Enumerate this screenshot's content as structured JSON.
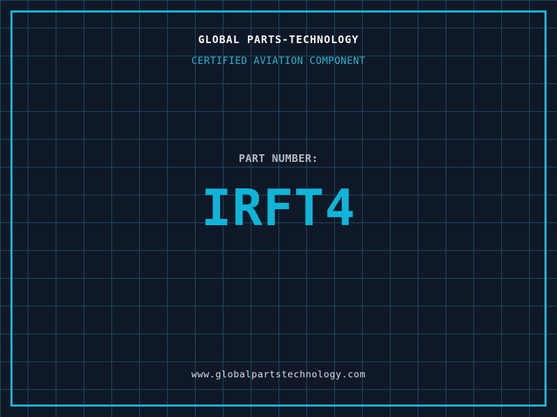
{
  "header": {
    "company_name": "GLOBAL PARTS-TECHNOLOGY",
    "tagline": "CERTIFIED AVIATION COMPONENT"
  },
  "part": {
    "label": "PART NUMBER:",
    "number": "IRFT4"
  },
  "footer": {
    "website": "www.globalpartstechnology.com"
  },
  "colors": {
    "bg": "#0f1827",
    "grid": "#1d4a63",
    "frame": "#13b7da",
    "title": "#f5f7f9",
    "tagline": "#25b7d8",
    "label": "#b4bac4",
    "partnum": "#0fb5d8",
    "url": "#d8dce2"
  }
}
